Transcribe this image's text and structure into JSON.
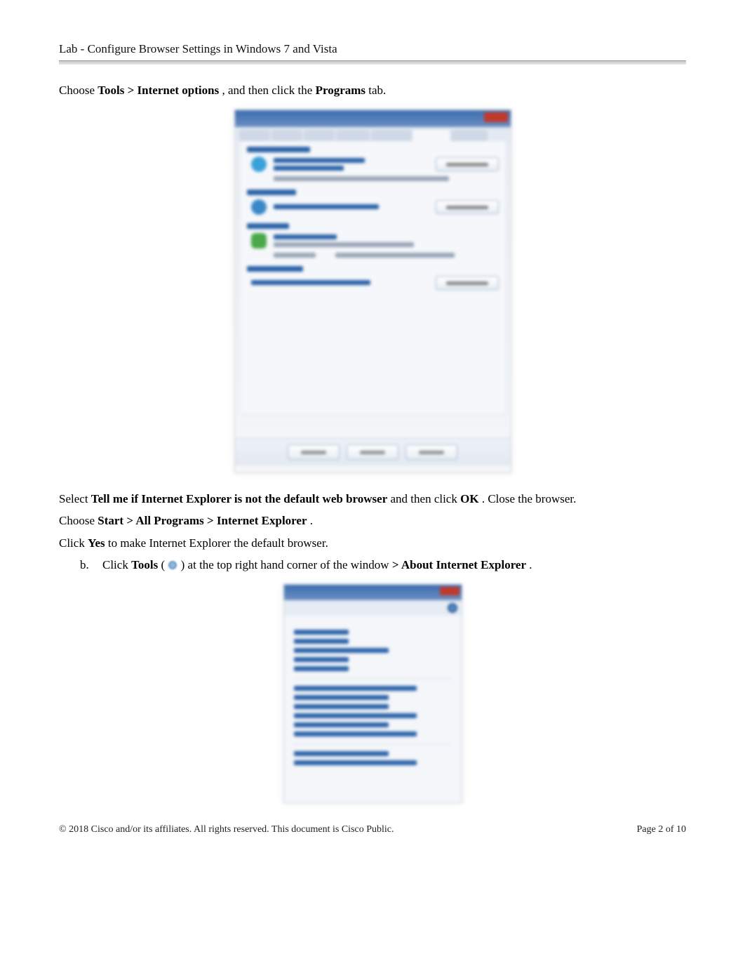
{
  "header": {
    "title": "Lab - Configure Browser Settings in Windows 7 and Vista"
  },
  "p1": {
    "pre": "Choose ",
    "bold": "Tools > Internet options",
    "mid": ", and then click the ",
    "bold2": "Programs",
    "post": " tab."
  },
  "p2": {
    "pre": "Select ",
    "bold": "Tell me if Internet Explorer is not the default web browser",
    "mid": " and then click ",
    "bold2": "OK",
    "post": ". Close the browser."
  },
  "p3": {
    "pre": "Choose ",
    "bold": "Start > All Programs > Internet Explorer",
    "post": "."
  },
  "p4": {
    "pre": "Click ",
    "bold": "Yes",
    "post": " to make Internet Explorer the default browser."
  },
  "step_b": {
    "marker": "b.",
    "pre": "Click ",
    "bold1": "Tools",
    "open_paren": " (",
    "close_paren": ") at the top right hand corner of the window",
    "gt": " > ",
    "bold2": "About Internet Explorer",
    "post": "."
  },
  "footer": {
    "left": "© 2018 Cisco and/or its affiliates. All rights reserved. This document is Cisco Public.",
    "right_pre": "Page ",
    "right_num": "2",
    "right_post": " of 10"
  }
}
